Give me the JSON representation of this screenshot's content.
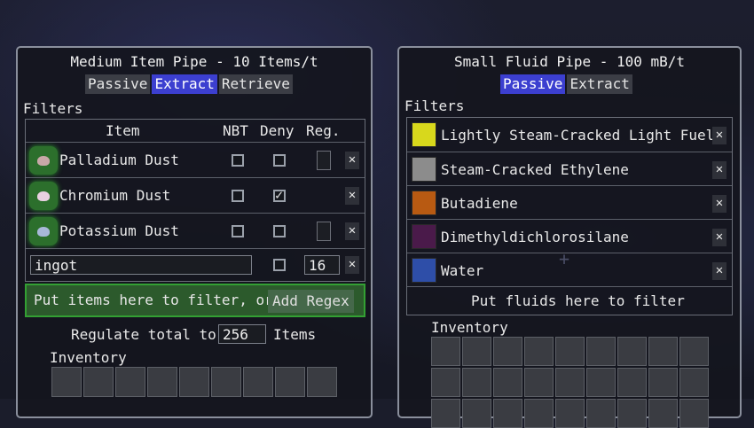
{
  "colors": {
    "accent": "#3c3fd0",
    "filter_drop_green": "#2c5a2c",
    "panel_border": "#8a8f9c"
  },
  "left": {
    "title": "Medium Item Pipe - 10 Items/t",
    "tabs": [
      {
        "label": "Passive",
        "active": false
      },
      {
        "label": "Extract",
        "active": true
      },
      {
        "label": "Retrieve",
        "active": false
      }
    ],
    "filters_label": "Filters",
    "columns": {
      "item": "Item",
      "nbt": "NBT",
      "deny": "Deny",
      "reg": "Reg."
    },
    "rows": [
      {
        "name": "Palladium Dust",
        "nbt": false,
        "deny": false,
        "icon": "palladium-dust-icon",
        "icon_color": "#c8a8a8"
      },
      {
        "name": "Chromium Dust",
        "nbt": false,
        "deny": true,
        "icon": "chromium-dust-icon",
        "icon_color": "#e8d0e0"
      },
      {
        "name": "Potassium Dust",
        "nbt": false,
        "deny": false,
        "icon": "potassium-dust-icon",
        "icon_color": "#a8b8d8"
      }
    ],
    "regex_row": {
      "value": "ingot",
      "nbt": false,
      "amount": "16"
    },
    "drop_hint": "Put items here to filter, or",
    "add_regex": "Add Regex",
    "regulate_label": "Regulate total to",
    "regulate_value": "256",
    "regulate_unit": "Items",
    "inventory_label": "Inventory"
  },
  "right": {
    "title": "Small Fluid Pipe - 100 mB/t",
    "tabs": [
      {
        "label": "Passive",
        "active": true
      },
      {
        "label": "Extract",
        "active": false
      }
    ],
    "filters_label": "Filters",
    "fluids": [
      {
        "name": "Lightly Steam-Cracked Light Fuel",
        "color": "#d8d81c"
      },
      {
        "name": "Steam-Cracked Ethylene",
        "color": "#8c8c8c"
      },
      {
        "name": "Butadiene",
        "color": "#b85a12"
      },
      {
        "name": "Dimethyldichlorosilane",
        "color": "#4a1a4a"
      },
      {
        "name": "Water",
        "color": "#2e4ea8"
      }
    ],
    "drop_hint": "Put fluids here to filter",
    "inventory_label": "Inventory"
  }
}
